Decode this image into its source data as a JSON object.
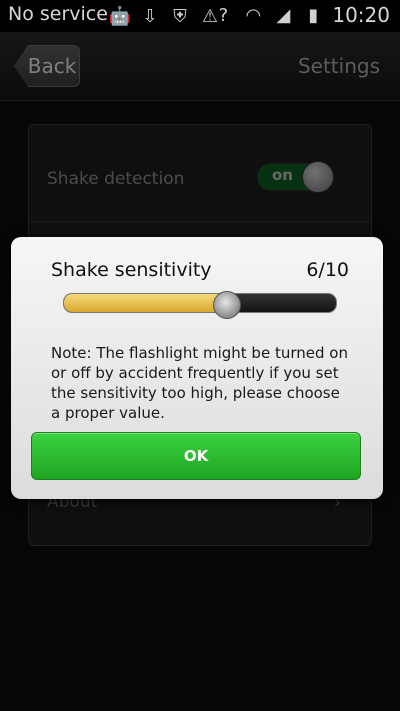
{
  "status_bar": {
    "carrier": "No service",
    "time": "10:20",
    "icons_left": [
      "android-debug-icon",
      "usb-icon",
      "shield-icon",
      "warning-icon"
    ],
    "icons_right": [
      "no-sim-icon",
      "wifi-icon",
      "signal-icon",
      "battery-icon"
    ]
  },
  "header": {
    "back_label": "Back",
    "title": "Settings"
  },
  "settings": {
    "shake_detection_label": "Shake detection",
    "shake_detection_toggle": "on",
    "about_label": "About"
  },
  "dialog": {
    "title": "Shake sensitivity",
    "value_text": "6/10",
    "slider_value": 6,
    "slider_max": 10,
    "note": "Note: The flashlight might be turned on or off by accident frequently if you set the sensitivity too high, please choose a proper value.",
    "ok_label": "OK"
  },
  "colors": {
    "accent_green": "#2bbf30",
    "slider_fill": "#e8c54f"
  }
}
